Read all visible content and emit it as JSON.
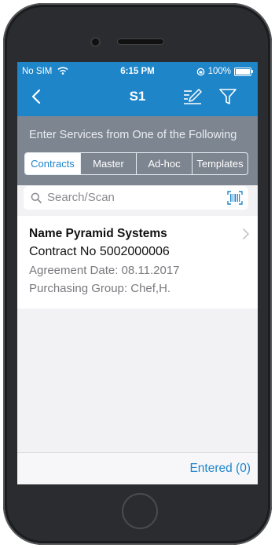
{
  "status_bar": {
    "carrier": "No SIM",
    "time": "6:15 PM",
    "battery": "100%"
  },
  "nav": {
    "title": "S1",
    "icons": [
      "chevron-left-icon",
      "edit-icon",
      "filter-icon"
    ]
  },
  "instruction": "Enter Services from One of the Following",
  "tabs": [
    {
      "label": "Contracts",
      "active": true
    },
    {
      "label": "Master",
      "active": false
    },
    {
      "label": "Ad-hoc",
      "active": false
    },
    {
      "label": "Templates",
      "active": false
    }
  ],
  "search": {
    "placeholder": "Search/Scan"
  },
  "list": [
    {
      "name": "Name Pyramid Systems",
      "contract": "Contract No 5002000006",
      "agreement": "Agreement Date: 08.11.2017",
      "group": "Purchasing Group: Chef,H."
    }
  ],
  "footer": {
    "entered": "Entered (0)"
  },
  "colors": {
    "accent": "#1f85c9",
    "subheader": "#7d8590"
  }
}
